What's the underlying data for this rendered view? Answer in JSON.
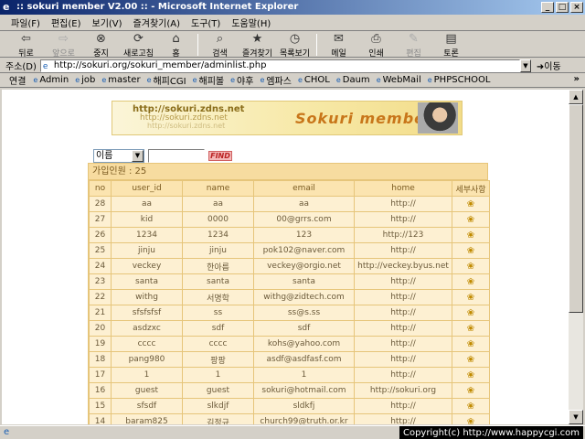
{
  "window": {
    "title": ":: sokuri member V2.00 :: - Microsoft Internet Explorer"
  },
  "menu": [
    "파일(F)",
    "편집(E)",
    "보기(V)",
    "즐겨찾기(A)",
    "도구(T)",
    "도움말(H)"
  ],
  "toolbar": {
    "back": "뒤로",
    "forward": "앞으로",
    "stop": "중지",
    "refresh": "새로고침",
    "home": "홈",
    "search": "검색",
    "favorites": "즐겨찾기",
    "history": "목록보기",
    "mail": "메일",
    "print": "인쇄",
    "edit": "편집",
    "discuss": "토론"
  },
  "address": {
    "label": "주소(D)",
    "url": "http://sokuri.org/sokuri_member/adminlist.php",
    "go": "이동"
  },
  "links": {
    "label": "연결",
    "items": [
      "Admin",
      "job",
      "master",
      "해피CGI",
      "해피볼",
      "야후",
      "엠파스",
      "CHOL",
      "Daum",
      "WebMail",
      "PHPSCHOOL"
    ]
  },
  "banner": {
    "url1": "http://sokuri.zdns.net",
    "url2": "http://sokuri.zdns.net",
    "url3": "http://sokuri.zdns.net",
    "title": "Sokuri member"
  },
  "search": {
    "field": "이름",
    "find_label": "FIND"
  },
  "members": {
    "count_label": "가입인원 : 25",
    "headers": [
      "no",
      "user_id",
      "name",
      "email",
      "home",
      "세부사항"
    ],
    "rows": [
      [
        "28",
        "aa",
        "aa",
        "aa",
        "http://"
      ],
      [
        "27",
        "kid",
        "0000",
        "00@grrs.com",
        "http://"
      ],
      [
        "26",
        "1234",
        "1234",
        "123",
        "http://123"
      ],
      [
        "25",
        "jinju",
        "jinju",
        "pok102@naver.com",
        "http://"
      ],
      [
        "24",
        "veckey",
        "한아름",
        "veckey@orgio.net",
        "http://veckey.byus.net"
      ],
      [
        "23",
        "santa",
        "santa",
        "santa",
        "http://"
      ],
      [
        "22",
        "withg",
        "서명학",
        "withg@zidtech.com",
        "http://"
      ],
      [
        "21",
        "sfsfsfsf",
        "ss",
        "ss@s.ss",
        "http://"
      ],
      [
        "20",
        "asdzxc",
        "sdf",
        "sdf",
        "http://"
      ],
      [
        "19",
        "cccc",
        "cccc",
        "kohs@yahoo.com",
        "http://"
      ],
      [
        "18",
        "pang980",
        "팡팡",
        "asdf@asdfasf.com",
        "http://"
      ],
      [
        "17",
        "1",
        "1",
        "1",
        "http://"
      ],
      [
        "16",
        "guest",
        "guest",
        "sokuri@hotmail.com",
        "http://sokuri.org"
      ],
      [
        "15",
        "sfsdf",
        "slkdjf",
        "sldkfj",
        "http://"
      ],
      [
        "14",
        "baram825",
        "김정규",
        "church99@truth.or.kr",
        "http://"
      ]
    ]
  },
  "status": {
    "copyright": "Copyright(c) http://www.happycgi.com"
  }
}
